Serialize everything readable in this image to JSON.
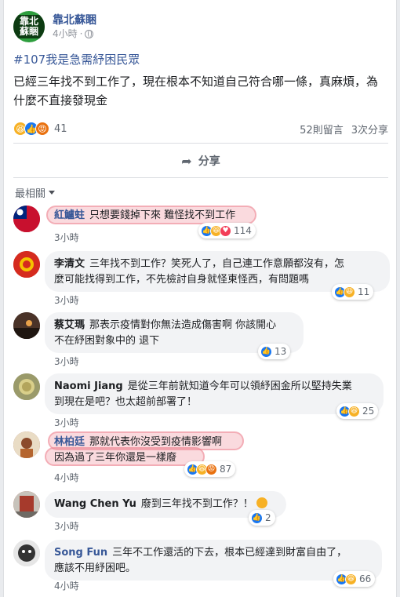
{
  "post": {
    "page_name": "靠北蘇睏",
    "logo_text": "靠北蘇睏",
    "time": "4小時",
    "hashtag": "#107我是急需紓困民眾",
    "text": "已經三年找不到工作了，現在根本不知道自己符合哪一條，真麻煩，為什麼不直接發現金",
    "reaction_count": "41",
    "comment_count": "52則留言",
    "share_count": "3次分享",
    "share_label": "分享",
    "sort_label": "最相關"
  },
  "comments": [
    {
      "name": "紅鱸蛀",
      "text": "只想要錢掉下來 難怪找不到工作",
      "time": "3小時",
      "reactions": "114"
    },
    {
      "name": "李清文",
      "text": "三年找不到工作？笑死人了，自己連工作意願都沒有，怎麼可能找得到工作，不先檢討自身就怪東怪西，有問題嗎",
      "line1": "三年找不到工作？笑死人了，自己連工作意願都沒有，怎",
      "line2": "麼可能找得到工作，不先檢討自身就怪東怪西，有問題嗎",
      "time": "3小時",
      "reactions": "11"
    },
    {
      "name": "蔡艾瑪",
      "line1": "那表示疫情對你無法造成傷害啊 你該開心",
      "line2": "不在紓困對象中的 退下",
      "time": "3小時",
      "reactions": "13"
    },
    {
      "name": "Naomi Jiang",
      "line1": "是從三年前就知道今年可以領紓困金所以堅持失業",
      "line2": "到現在是吧？也太超前部署了！",
      "time": "3小時",
      "reactions": "25"
    },
    {
      "name": "林柏廷",
      "line1": "那就代表你沒受到疫情影響啊",
      "line2": "因為過了三年你還是一樣廢",
      "time": "4小時",
      "reactions": "87"
    },
    {
      "name": "Wang Chen Yu",
      "text": "廢到三年找不到工作？！",
      "time": "3小時",
      "reactions": "2"
    },
    {
      "name": "Song Fun",
      "line1": "三年不工作還活的下去，根本已經達到財富自由了，",
      "line2": "應該不用紓困吧。",
      "time": "4小時",
      "reactions": "66"
    }
  ],
  "colors": {
    "link": "#385898",
    "like": "#1877f2",
    "haha": "#f7b125",
    "angry": "#e9710f",
    "love": "#f33e58"
  },
  "icons": [
    "globe-icon",
    "share-arrow-icon",
    "caret-down-icon",
    "like-icon",
    "haha-icon",
    "angry-icon",
    "love-icon"
  ]
}
